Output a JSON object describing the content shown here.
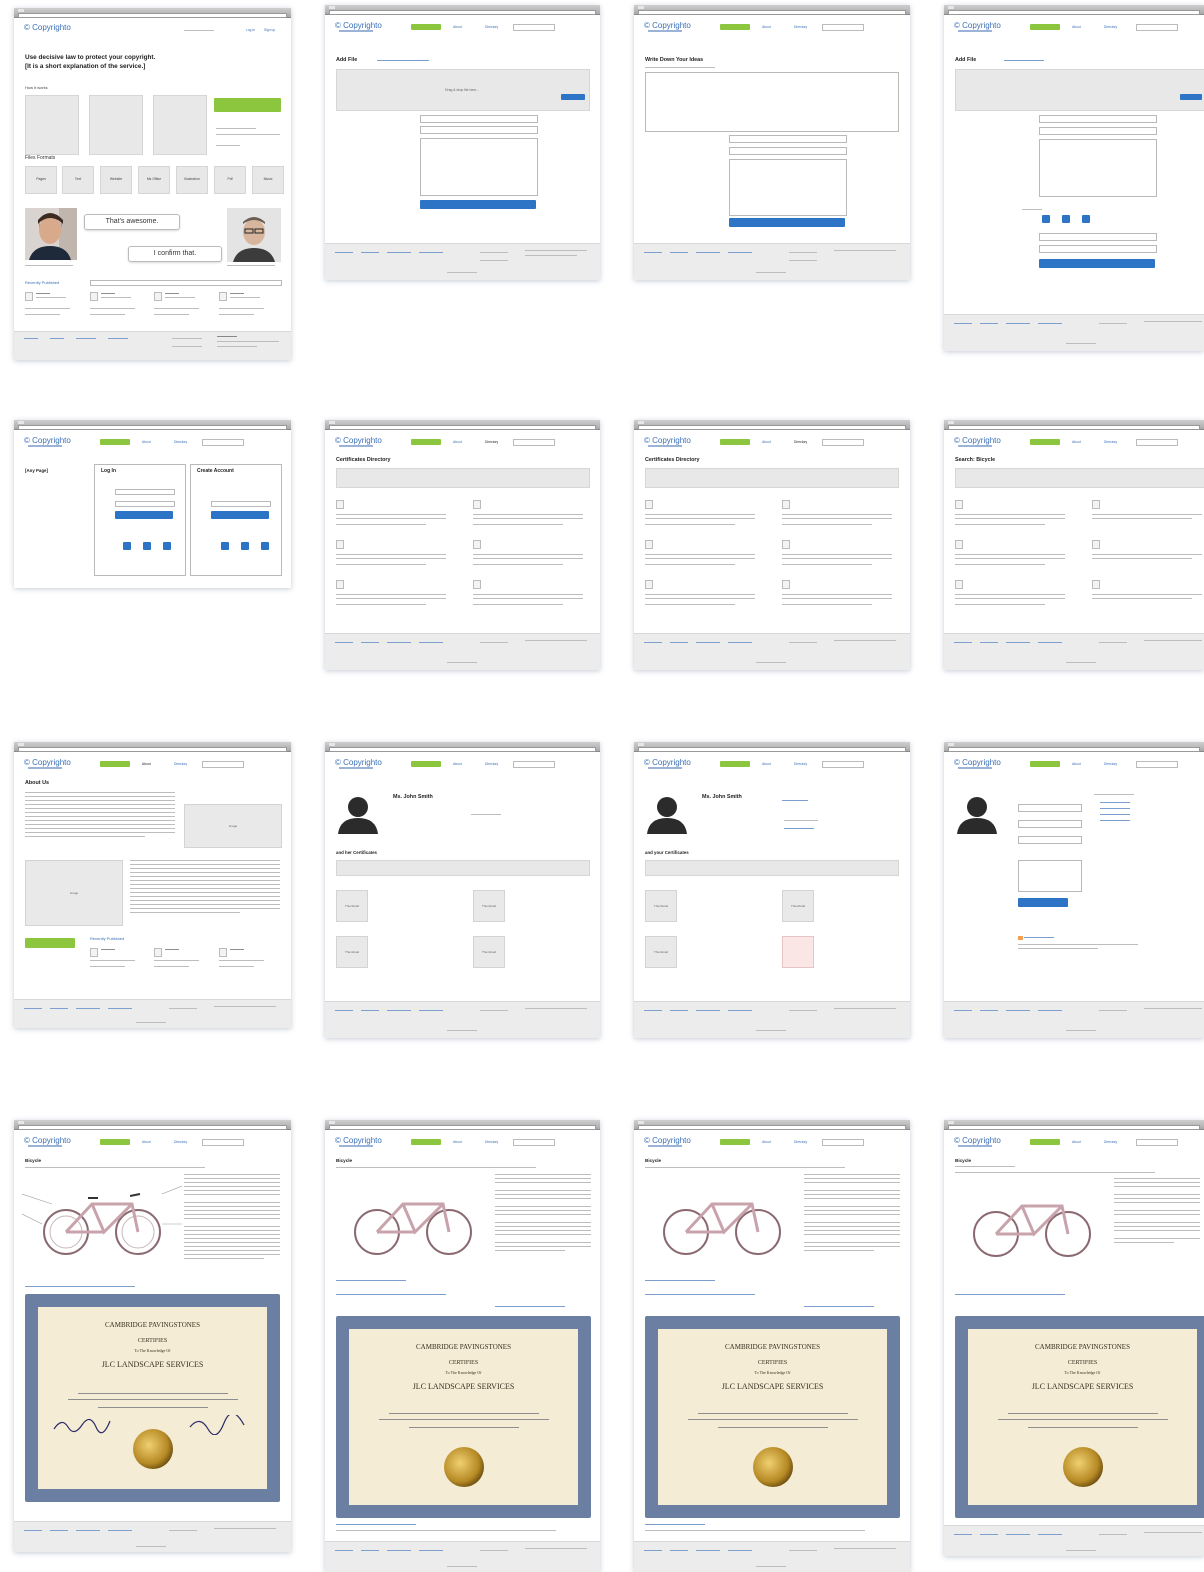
{
  "colors": {
    "accent": "#3a6fb7",
    "primary_button": "#8cc63f",
    "action_button": "#2e74c6",
    "panel_grey": "#e8e8e8",
    "certificate_border": "#6b7fa3",
    "certificate_paper": "#f4ecd4",
    "seal_gold": "#c9a235"
  },
  "brand": {
    "name": "Copyrighto"
  },
  "home": {
    "headline": "Use decisive law to protect your copyright.",
    "subheadline": "[It is a short explanation of the service.]",
    "how_it_works": "How it works",
    "file_formats": "Files Formats",
    "formats": [
      "Pages",
      "Text",
      "Website",
      "Ms Office",
      "Illustration",
      "Pdf",
      "Music"
    ],
    "bubble_1": "That's awesome.",
    "bubble_2": "I confirm that.",
    "recently_published": "Recently Published"
  },
  "pages": {
    "add_file": "Add File",
    "write_idea": "Write Down Your Ideas",
    "any_page": "[Any Page]",
    "log_in": "Log In",
    "create_account": "Create Account",
    "certificates_directory": "Certificates Directory",
    "about_us": "About Us",
    "profile_name": "Ms. John Smith",
    "my_certificates": "and her Certificates",
    "your_certificates": "and your Certificates",
    "bicycle": "Bicycle",
    "drag_drop": "Drag & drop file here..."
  },
  "certificate": {
    "org": "CAMBRIDGE PAVINGSTONES",
    "certifies": "CERTIFIES",
    "to": "To The Knowledge Of",
    "company": "JLC LANDSCAPE SERVICES"
  }
}
